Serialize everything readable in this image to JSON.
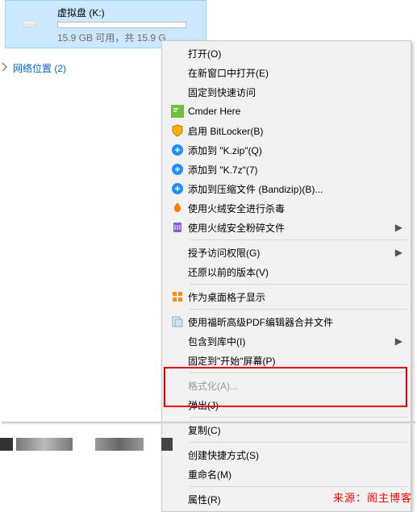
{
  "drive": {
    "name": "虚拟盘 (K:)",
    "detail": "15.9 GB 可用，共 15.9 G"
  },
  "tree": {
    "label": "网络位置 (2)"
  },
  "menu": {
    "open": "打开(O)",
    "open_new_window": "在新窗口中打开(E)",
    "pin_quick_access": "固定到快速访问",
    "cmder_here": "Cmder Here",
    "bitlocker": "启用 BitLocker(B)",
    "add_kzip": "添加到 \"K.zip\"(Q)",
    "add_k7z": "添加到 \"K.7z\"(7)",
    "add_bandizip": "添加到压缩文件 (Bandizip)(B)...",
    "huorong_scan": "使用火绒安全进行杀毒",
    "huorong_shred": "使用火绒安全粉碎文件",
    "grant_access": "授予访问权限(G)",
    "restore_prev": "还原以前的版本(V)",
    "desktop_grid": "作为桌面格子显示",
    "foxit_merge": "使用福昕高级PDF编辑器合并文件",
    "include_lib": "包含到库中(I)",
    "pin_start": "固定到\"开始\"屏幕(P)",
    "format": "格式化(A)...",
    "eject": "弹出(J)",
    "copy": "复制(C)",
    "create_shortcut": "创建快捷方式(S)",
    "rename": "重命名(M)",
    "properties": "属性(R)"
  },
  "watermark": "来源：阁主博客"
}
